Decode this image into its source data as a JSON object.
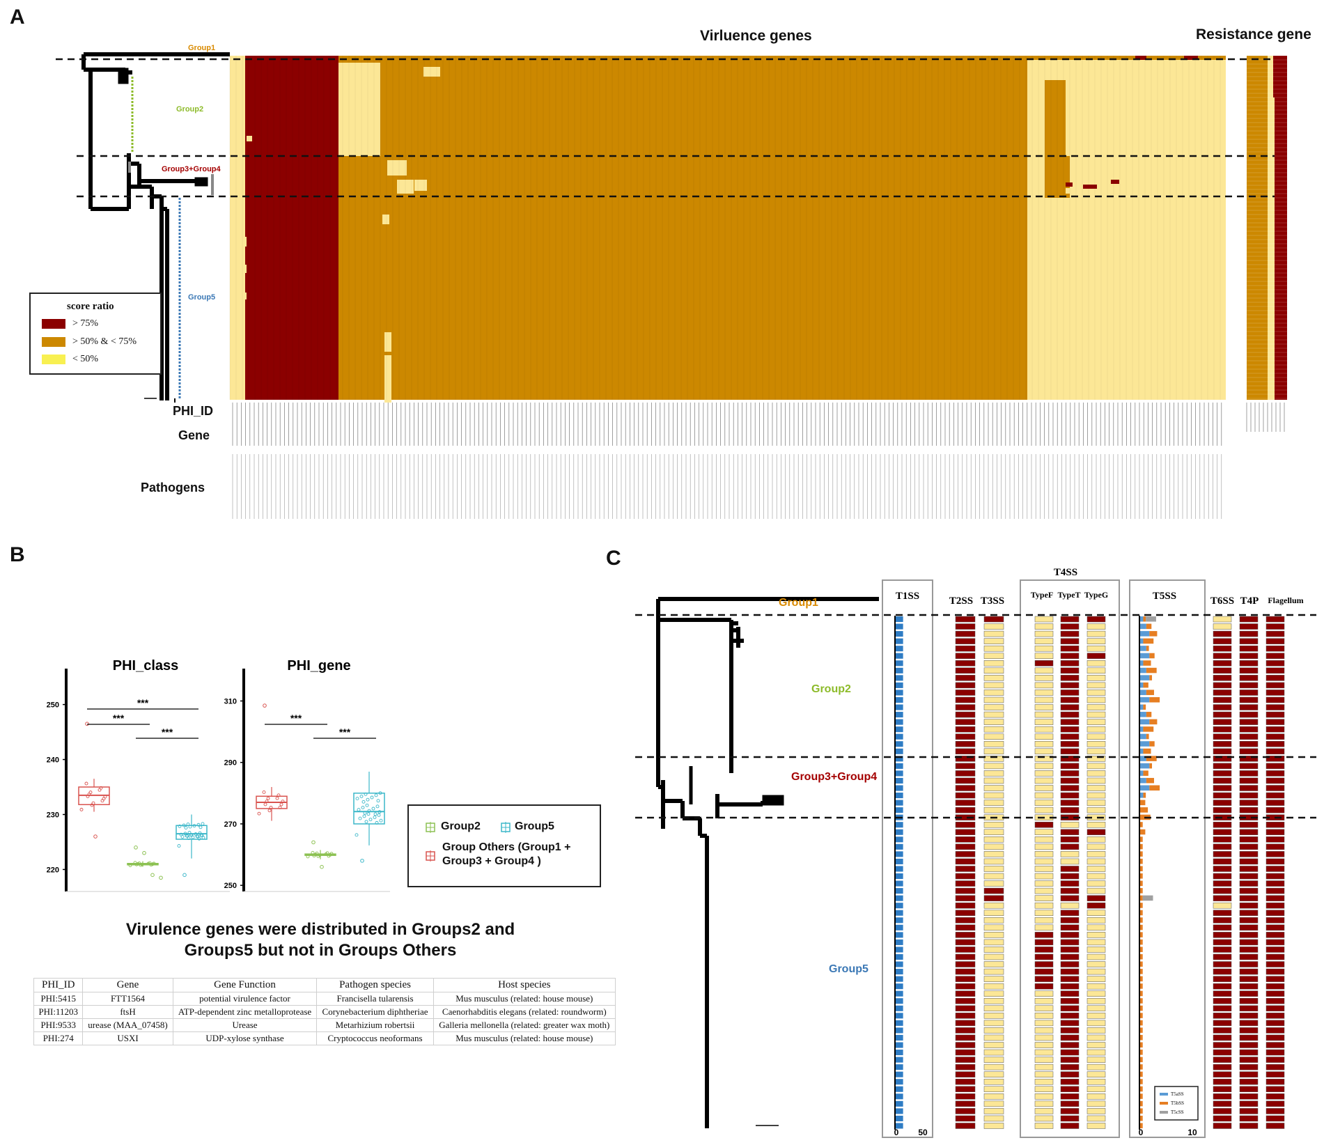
{
  "panels": {
    "a": "A",
    "b": "B",
    "c": "C"
  },
  "colors": {
    "high": "#8b0000",
    "mid": "#cc8800",
    "low": "#fce796",
    "t1": "#2e7cc4",
    "t5a": "#5a9bd5",
    "t5b": "#e67e22",
    "t5c": "#a0a0a0",
    "group1": "#d98a00",
    "group2": "#8dbb2a",
    "group34": "#a40000",
    "group5": "#3b78b5",
    "box_red": "#d9534f",
    "box_green": "#8cc152",
    "box_cyan": "#3bb7c9"
  },
  "panelA": {
    "title_virulence": "Virluence genes",
    "title_resistance": "Resistance gene",
    "groups": [
      "Group1",
      "Group2",
      "Group3+Group4",
      "Group5"
    ],
    "legend": {
      "title": "score ratio",
      "items": [
        "> 75%",
        "> 50% & < 75%",
        "< 50%"
      ]
    },
    "row_labels": [
      "PHI_ID",
      "Gene",
      "Pathogens"
    ]
  },
  "panelB": {
    "caption": "Virulence genes were distributed in Groups2 and Groups5 but not in Groups Others",
    "legend": {
      "group2": "Group2",
      "group5": "Group5",
      "others": "Group Others (Group1 + Group3 + Group4 )"
    },
    "sig": "***",
    "table": {
      "headers": [
        "PHI_ID",
        "Gene",
        "Gene Function",
        "Pathogen species",
        "Host species"
      ],
      "rows": [
        [
          "PHI:5415",
          "FTT1564",
          "potential virulence factor",
          "Francisella tularensis",
          "Mus musculus (related: house mouse)"
        ],
        [
          "PHI:11203",
          "ftsH",
          "ATP-dependent zinc metalloprotease",
          "Corynebacterium diphtheriae",
          "Caenorhabditis elegans (related: roundworm)"
        ],
        [
          "PHI:9533",
          "urease (MAA_07458)",
          "Urease",
          "Metarhizium robertsii",
          "Galleria mellonella (related: greater wax moth)"
        ],
        [
          "PHI:274",
          "USXI",
          "UDP-xylose synthase",
          "Cryptococcus neoformans",
          "Mus musculus (related: house mouse)"
        ]
      ]
    }
  },
  "panelC": {
    "groups": [
      "Group1",
      "Group2",
      "Group3+Group4",
      "Group5"
    ],
    "columns": [
      "T1SS",
      "T2SS",
      "T3SS",
      "T4SS",
      "TypeF",
      "TypeT",
      "TypeG",
      "T5SS",
      "T6SS",
      "T4P",
      "Flagellum"
    ],
    "t1_ticks": [
      "0",
      "50"
    ],
    "t5_ticks": [
      "0",
      "10"
    ],
    "t5_legend": [
      "T5aSS",
      "T5bSS",
      "T5cSS"
    ]
  },
  "chart_data": [
    {
      "type": "heatmap",
      "title": "Virluence genes",
      "xlabel": "",
      "ylabel": "",
      "row_groups": [
        "Group1",
        "Group2",
        "Group3+Group4",
        "Group5"
      ],
      "scale": [
        "> 75%",
        "> 50% & < 75%",
        "< 50%"
      ]
    },
    {
      "type": "heatmap",
      "title": "Resistance gene",
      "xlabel": "",
      "ylabel": ""
    },
    {
      "type": "box",
      "title": "PHI_class",
      "ylim": [
        216,
        254
      ],
      "yticks": [
        220,
        230,
        240,
        250
      ],
      "series": [
        {
          "name": "Group Others (Group1 + Group3 + Group4 )",
          "median": 233.5,
          "q1": 231.8,
          "q3": 235.0,
          "min": 230.5,
          "max": 236.5,
          "outliers": [
            246.5,
            226
          ]
        },
        {
          "name": "Group2",
          "median": 221,
          "q1": 220.9,
          "q3": 221.1,
          "min": 220.5,
          "max": 221.5,
          "outliers": [
            224,
            223,
            219,
            218.5
          ]
        },
        {
          "name": "Group5",
          "median": 226.5,
          "q1": 225.5,
          "q3": 228,
          "min": 222,
          "max": 230,
          "outliers": [
            219
          ]
        }
      ],
      "significance": [
        {
          "pair": [
            "Group Others (Group1 + Group3 + Group4 )",
            "Group2"
          ],
          "label": "***"
        },
        {
          "pair": [
            "Group Others (Group1 + Group3 + Group4 )",
            "Group5"
          ],
          "label": "***"
        },
        {
          "pair": [
            "Group2",
            "Group5"
          ],
          "label": "***"
        }
      ]
    },
    {
      "type": "box",
      "title": "PHI_gene",
      "ylim": [
        248,
        316
      ],
      "yticks": [
        250,
        270,
        290,
        310
      ],
      "series": [
        {
          "name": "Group Others (Group1 + Group3 + Group4 )",
          "median": 277,
          "q1": 275,
          "q3": 279,
          "min": 271,
          "max": 282,
          "outliers": [
            308.5
          ]
        },
        {
          "name": "Group2",
          "median": 260,
          "q1": 259.8,
          "q3": 260.2,
          "min": 258.5,
          "max": 261.5,
          "outliers": [
            264,
            256
          ]
        },
        {
          "name": "Group5",
          "median": 274,
          "q1": 270,
          "q3": 280,
          "min": 263,
          "max": 287,
          "outliers": [
            258
          ]
        }
      ],
      "significance": [
        {
          "pair": [
            "Group Others (Group1 + Group3 + Group4 )",
            "Group2"
          ],
          "label": "***"
        },
        {
          "pair": [
            "Group2",
            "Group5"
          ],
          "label": "***"
        }
      ]
    },
    {
      "type": "bar",
      "title": "T1SS",
      "xlim": [
        0,
        50
      ],
      "values_note_rows": 70,
      "value": 14
    },
    {
      "type": "bar",
      "title": "T5SS",
      "xlim": [
        0,
        10
      ],
      "series": [
        {
          "name": "T5aSS"
        },
        {
          "name": "T5bSS"
        },
        {
          "name": "T5cSS"
        }
      ]
    }
  ]
}
